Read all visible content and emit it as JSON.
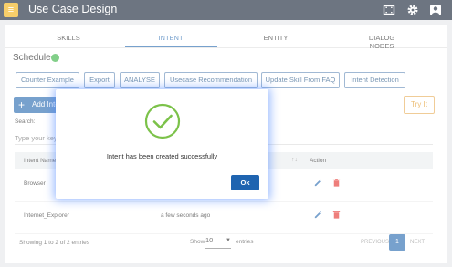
{
  "topbar": {
    "title": "Use Case Design",
    "menu_icon": "hamburger-icon",
    "icons": [
      "screenshot-icon",
      "gear-icon",
      "account-icon"
    ]
  },
  "tabs": [
    {
      "label": "SKILLS",
      "active": false
    },
    {
      "label": "INTENT",
      "active": true
    },
    {
      "label": "ENTITY",
      "active": false
    },
    {
      "label": "DIALOG NODES",
      "active": false
    }
  ],
  "schedule": {
    "label": "Schedule",
    "status_color": "#3fb54a"
  },
  "toolbar": {
    "buttons": [
      "Counter Example",
      "Export",
      "ANALYSE",
      "Usecase Recommendation",
      "Update Skill From FAQ",
      "Intent Detection"
    ]
  },
  "actions": {
    "add_intent_label": "Add Inte",
    "try_it_label": "Try It"
  },
  "search": {
    "label": "Search:",
    "placeholder": "Type your key"
  },
  "table": {
    "headers": {
      "intent_name": "Intent Name",
      "action": "Action"
    },
    "rows": [
      {
        "intent_name": "Browser",
        "updated": ""
      },
      {
        "intent_name": "Internet_Explorer",
        "updated": "a few seconds ago"
      }
    ]
  },
  "footer": {
    "info": "Showing 1 to 2 of 2 entries",
    "show_label": "Show",
    "show_value": "10",
    "entries_label": "entries",
    "prev": "PREVIOUS",
    "page": "1",
    "next": "NEXT"
  },
  "modal": {
    "message": "Intent has been created successfully",
    "ok_label": "Ok",
    "icon": "check-circle-icon",
    "icon_color": "#7cc24a"
  },
  "colors": {
    "accent": "#2f6fb3",
    "topbar": "#1f2c3e",
    "menu": "#f3b41b",
    "delete": "#e53935",
    "try_it": "#e39c2e"
  }
}
